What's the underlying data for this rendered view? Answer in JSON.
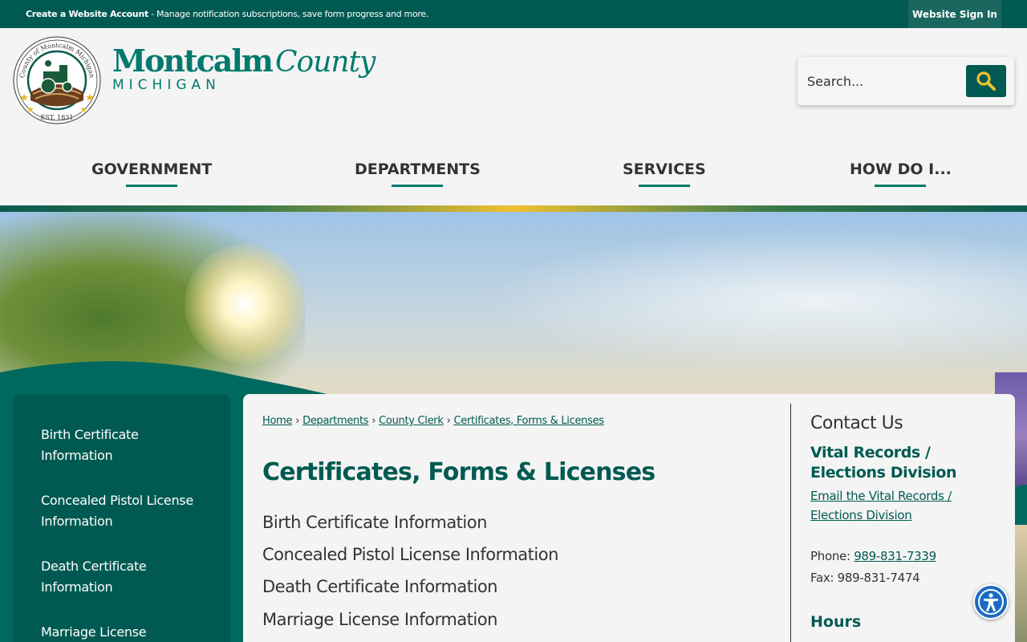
{
  "topbar": {
    "account_bold": "Create a Website Account",
    "account_rest": " - Manage notification subscriptions, save form progress and more.",
    "signin_label": "Website Sign In"
  },
  "header": {
    "logo_line1": "Montcalm",
    "logo_line1b": "County",
    "logo_line2": "MICHIGAN",
    "seal_top_text": "County of Montcalm Michigan",
    "seal_bottom_text": "EST. 1831",
    "search_placeholder": "Search..."
  },
  "nav": {
    "items": [
      {
        "label": "GOVERNMENT"
      },
      {
        "label": "DEPARTMENTS"
      },
      {
        "label": "SERVICES"
      },
      {
        "label": "HOW DO I..."
      }
    ]
  },
  "sidebar": {
    "items": [
      {
        "label": "Birth Certificate Information"
      },
      {
        "label": "Concealed Pistol License Information"
      },
      {
        "label": "Death Certificate Information"
      },
      {
        "label": "Marriage License"
      }
    ]
  },
  "main": {
    "breadcrumb": [
      {
        "label": "Home"
      },
      {
        "label": "Departments"
      },
      {
        "label": "County Clerk"
      },
      {
        "label": "Certificates, Forms & Licenses"
      }
    ],
    "breadcrumb_sep": "›",
    "title": "Certificates, Forms & Licenses",
    "links": [
      {
        "label": "Birth Certificate Information"
      },
      {
        "label": "Concealed Pistol License Information"
      },
      {
        "label": "Death Certificate Information"
      },
      {
        "label": "Marriage License Information"
      }
    ]
  },
  "contact": {
    "heading": "Contact Us",
    "division": "Vital Records / Elections Division",
    "email_link": "Email the Vital Records / Elections Division",
    "phone_label": "Phone: ",
    "phone": "989-831-7339",
    "fax_label": "Fax: ",
    "fax": "989-831-7474",
    "hours_heading": "Hours"
  },
  "colors": {
    "brand_dark": "#005a52",
    "brand": "#007a6e",
    "accent_gold": "#f0c030",
    "accessibility_blue": "#1a6bc4"
  },
  "icons": {
    "search": "search-icon",
    "accessibility": "accessibility-icon",
    "seal": "county-seal-icon"
  }
}
